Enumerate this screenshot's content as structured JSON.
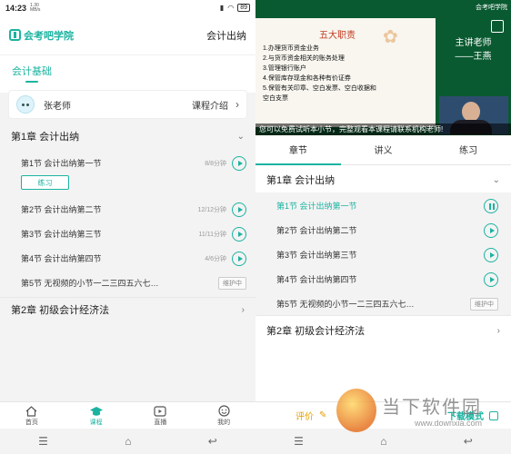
{
  "left": {
    "status": {
      "time": "14:23",
      "net_speed": "1.30",
      "net_unit": "MB/s",
      "battery": "89"
    },
    "header": {
      "brand": "会考吧学院",
      "course_title": "会计出纳"
    },
    "tab_active": "会计基础",
    "teacher": {
      "name": "张老师",
      "intro_label": "课程介绍"
    },
    "chapters": [
      {
        "title": "第1章 会计出纳"
      },
      {
        "title": "第2章 初级会计经济法"
      }
    ],
    "lessons": [
      {
        "title": "第1节 会计出纳第一节",
        "duration": "8/8分钟"
      },
      {
        "title": "第2节 会计出纳第二节",
        "duration": "12/12分钟"
      },
      {
        "title": "第3节 会计出纳第三节",
        "duration": "11/11分钟"
      },
      {
        "title": "第4节 会计出纳第四节",
        "duration": "4/6分钟"
      },
      {
        "title": "第5节 无视频的小节一二三四五六七…",
        "badge": "维护中"
      }
    ],
    "practice_label": "练习",
    "bottom_nav": [
      {
        "label": "首页",
        "icon": "home-icon"
      },
      {
        "label": "课程",
        "icon": "graduation-cap-icon"
      },
      {
        "label": "直播",
        "icon": "live-icon"
      },
      {
        "label": "我的",
        "icon": "smile-icon"
      }
    ]
  },
  "right": {
    "video": {
      "logo": "会考吧学院",
      "slide_title": "五大职责",
      "slide_lines": [
        "1.办理货币资金业务",
        "2.与货币资金相关的账务处理",
        "3.管理银行账户",
        "4.保管库存现金和各种有价证券",
        "5.保管有关印章、空白发票、空白收据和",
        "空白支票"
      ],
      "teacher_role": "主讲老师",
      "teacher_name": "——王燕",
      "caption": "您可以免费试听本小节，完整观看本课程请联系机构老师!"
    },
    "tabs": [
      "章节",
      "讲义",
      "练习"
    ],
    "chapters": [
      {
        "title": "第1章 会计出纳"
      },
      {
        "title": "第2章 初级会计经济法"
      }
    ],
    "lessons": [
      {
        "title": "第1节 会计出纳第一节",
        "state": "playing"
      },
      {
        "title": "第2节 会计出纳第二节"
      },
      {
        "title": "第3节 会计出纳第三节"
      },
      {
        "title": "第4节 会计出纳第四节"
      },
      {
        "title": "第5节 无视频的小节一二三四五六七…",
        "badge": "维护中"
      }
    ],
    "bottom": {
      "rate_label": "评价",
      "download_label": "下载模式"
    },
    "watermark": {
      "name": "当下软件园",
      "url": "www.downxia.com"
    }
  },
  "colors": {
    "accent": "#1bb3a0",
    "video_bg": "#0a5a31",
    "rate": "#e5a100"
  }
}
